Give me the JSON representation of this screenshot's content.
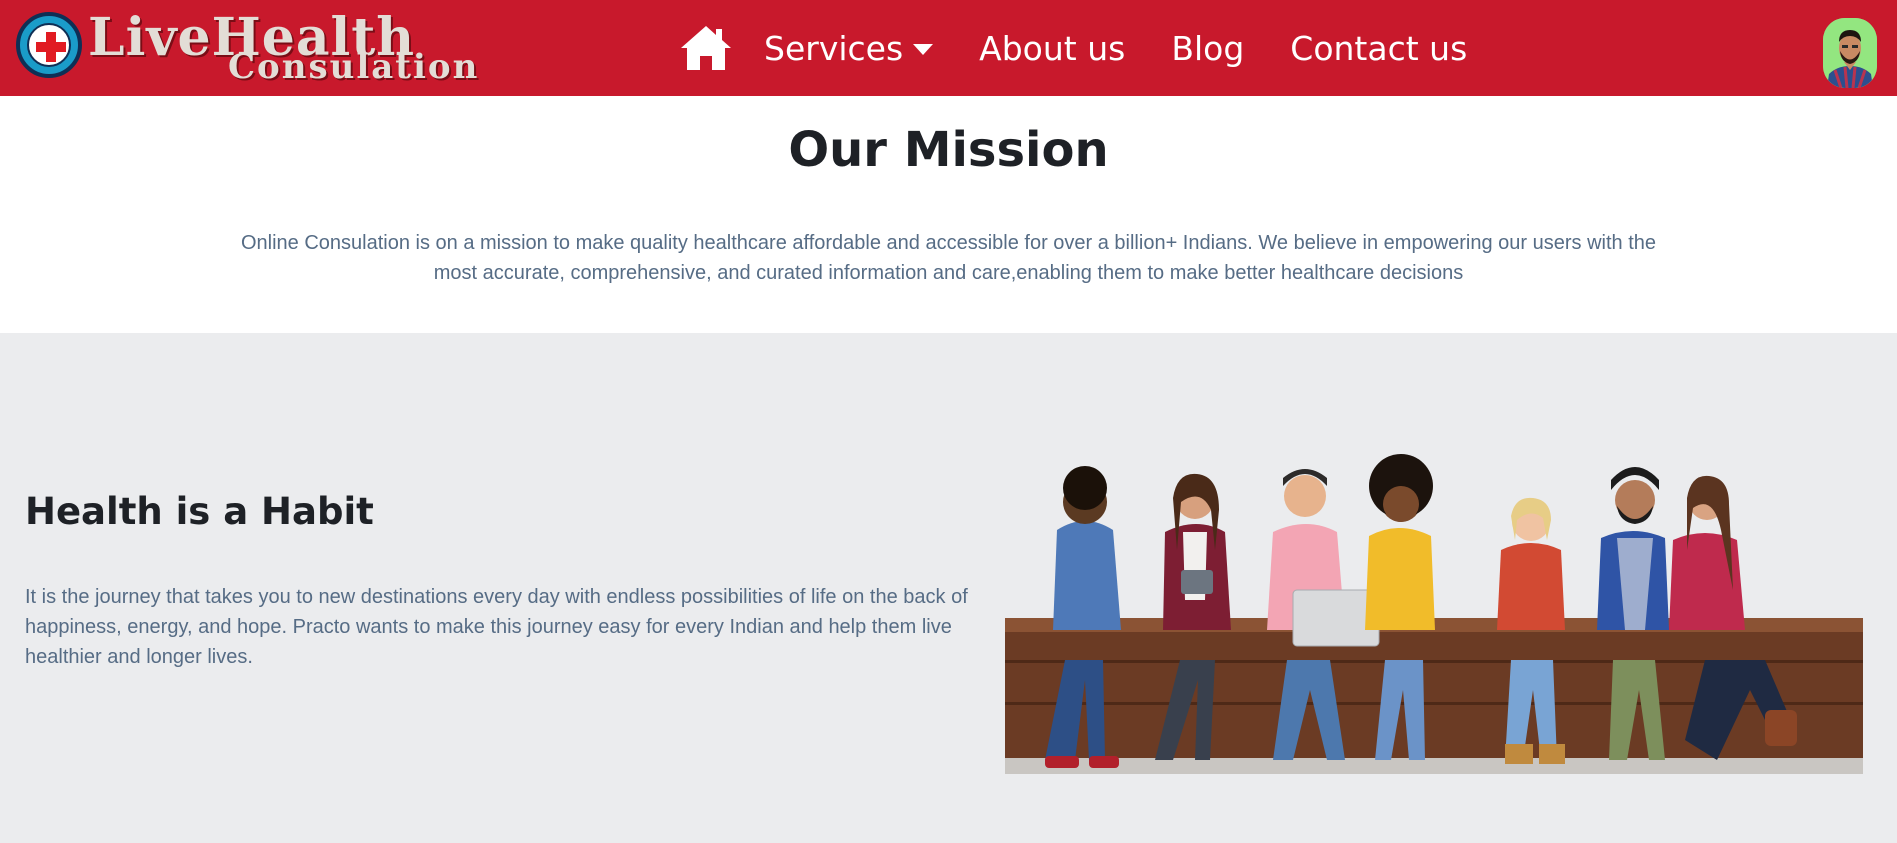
{
  "brand": {
    "line1": "LiveHealth",
    "line2": "Consulation"
  },
  "nav": {
    "home_icon": "home-icon",
    "items": [
      {
        "label": "Services",
        "has_dropdown": true
      },
      {
        "label": "About us"
      },
      {
        "label": "Blog"
      },
      {
        "label": "Contact us"
      }
    ]
  },
  "colors": {
    "navbar": "#c8192c",
    "section_bg": "#ebecee",
    "body_text": "#566c85"
  },
  "mission": {
    "title": "Our Mission",
    "text": "Online Consulation is on a mission to make quality healthcare affordable and accessible for over a billion+ Indians. We believe in empowering our users with the most accurate, comprehensive, and curated information and care,enabling them to make better healthcare decisions"
  },
  "habit": {
    "title": "Health is a Habit",
    "text": "It is the journey that takes you to new destinations every day with endless possibilities of life on the back of happiness, energy, and hope. Practo wants to make this journey easy for every Indian and help them live healthier and longer lives."
  }
}
